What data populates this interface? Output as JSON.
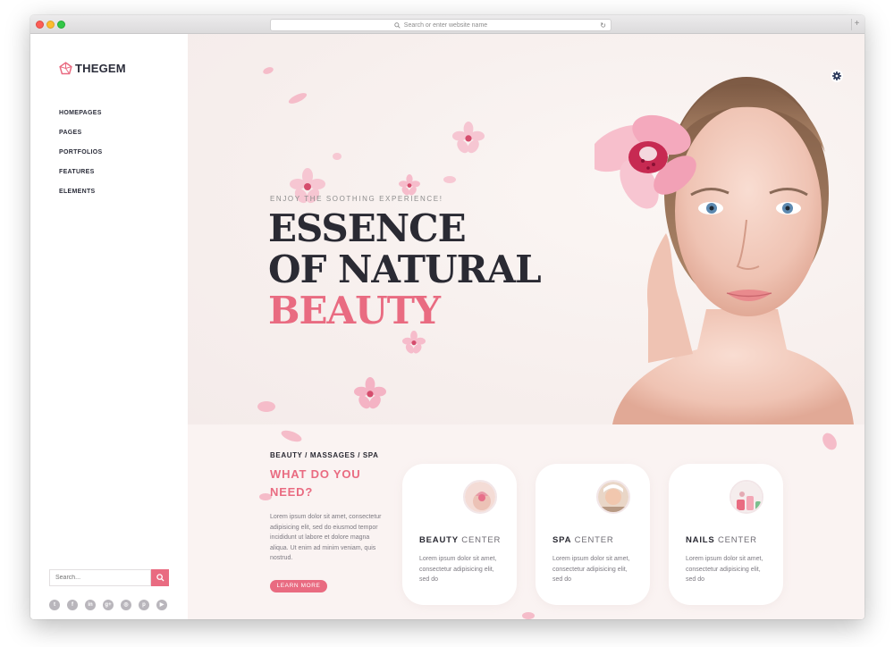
{
  "browser": {
    "url_placeholder": "Search or enter website name"
  },
  "sidebar": {
    "logo_text": "THEGEM",
    "nav": [
      {
        "label": "HOMEPAGES"
      },
      {
        "label": "PAGES"
      },
      {
        "label": "PORTFOLIOS"
      },
      {
        "label": "FEATURES"
      },
      {
        "label": "ELEMENTS"
      }
    ],
    "search_placeholder": "Search...",
    "social_icons": [
      "twitter-icon",
      "facebook-icon",
      "linkedin-icon",
      "googleplus-icon",
      "instagram-icon",
      "pinterest-icon",
      "youtube-icon"
    ]
  },
  "hero": {
    "kicker": "ENJOY THE SOOTHING EXPERIENCE!",
    "line1": "ESSENCE",
    "line2": "OF NATURAL",
    "line3": "BEAUTY"
  },
  "services": {
    "crumb": "BEAUTY / MASSAGES / SPA",
    "heading_line1": "WHAT DO YOU",
    "heading_line2": "NEED?",
    "text": "Lorem ipsum dolor sit amet, consectetur adipisicing elit, sed do eiusmod tempor incididunt ut labore et dolore magna aliqua. Ut enim ad minim veniam, quis nostrud.",
    "button": "LEARN MORE",
    "cards": [
      {
        "bold": "BEAUTY",
        "light": " CENTER",
        "text": "Lorem ipsum dolor sit amet, consectetur adipisicing elit, sed do"
      },
      {
        "bold": "SPA",
        "light": " CENTER",
        "text": "Lorem ipsum dolor sit amet, consectetur adipisicing elit, sed do"
      },
      {
        "bold": "NAILS",
        "light": " CENTER",
        "text": "Lorem ipsum dolor sit amet, consectetur adipisicing elit, sed do"
      }
    ]
  },
  "colors": {
    "accent": "#e96b81",
    "dark": "#2a2a33",
    "background": "#faf4f3"
  }
}
